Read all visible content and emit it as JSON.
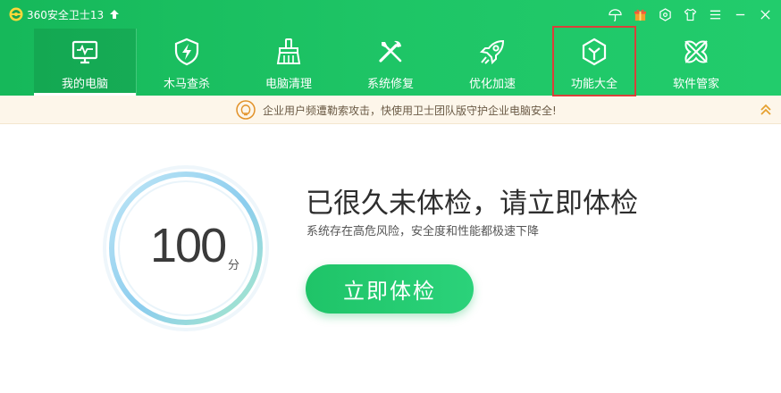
{
  "app": {
    "title": "360安全卫士13",
    "logo_icon": "360-logo-icon",
    "update_icon": "arrow-up-icon"
  },
  "window_controls": [
    {
      "name": "umbrella-icon"
    },
    {
      "name": "gift-icon"
    },
    {
      "name": "skin-icon"
    },
    {
      "name": "shirt-icon"
    },
    {
      "name": "menu-icon"
    },
    {
      "name": "minimize-icon"
    },
    {
      "name": "close-icon"
    }
  ],
  "nav": {
    "items": [
      {
        "label": "我的电脑",
        "icon": "monitor-icon"
      },
      {
        "label": "木马查杀",
        "icon": "shield-bolt-icon"
      },
      {
        "label": "电脑清理",
        "icon": "broom-icon"
      },
      {
        "label": "系统修复",
        "icon": "wrench-icon"
      },
      {
        "label": "优化加速",
        "icon": "rocket-icon"
      },
      {
        "label": "功能大全",
        "icon": "cube-icon"
      },
      {
        "label": "软件管家",
        "icon": "clover-icon"
      }
    ],
    "active_index": 0
  },
  "notice": {
    "text": "企业用户频遭勒索攻击，快使用卫士团队版守护企业电脑安全!",
    "icon": "bulb-icon",
    "collapse_icon": "double-chevron-up-icon"
  },
  "score": {
    "value": "100",
    "unit": "分"
  },
  "status": {
    "headline": "已很久未体检，请立即体检",
    "subline": "系统存在高危风险，安全度和性能都极速下降"
  },
  "actions": {
    "check_label": "立即体检"
  },
  "colors": {
    "brand": "#1ec566",
    "highlight": "#d9403a",
    "notice_bg": "#fdf6ea"
  }
}
